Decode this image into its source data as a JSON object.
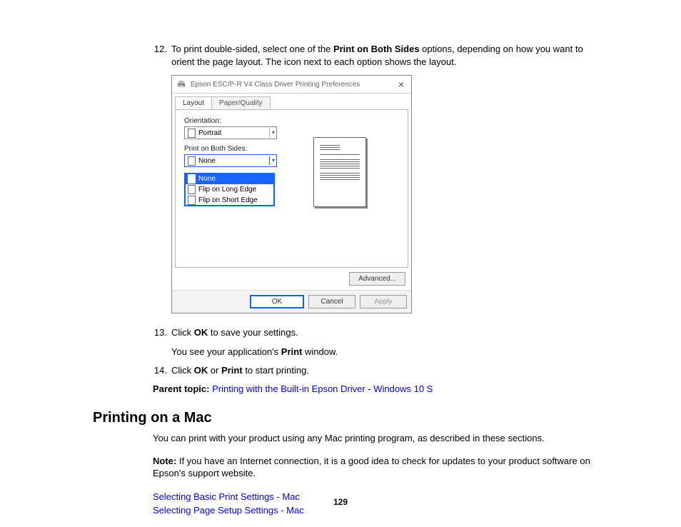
{
  "steps": {
    "s12": {
      "num": "12.",
      "text_before": "To print double-sided, select one of the ",
      "bold1": "Print on Both Sides",
      "text_after": " options, depending on how you want to orient the page layout. The icon next to each option shows the layout."
    },
    "s13": {
      "num": "13.",
      "text_before": "Click ",
      "bold1": "OK",
      "text_after": " to save your settings."
    },
    "s13_sub": {
      "text_before": "You see your application's ",
      "bold1": "Print",
      "text_after": " window."
    },
    "s14": {
      "num": "14.",
      "text_before": "Click ",
      "bold1": "OK",
      "mid": " or ",
      "bold2": "Print",
      "text_after": " to start printing."
    }
  },
  "parent_topic": {
    "label": "Parent topic:",
    "link": "Printing with the Built-in Epson Driver - Windows 10 S"
  },
  "heading": "Printing on a Mac",
  "para1": "You can print with your product using any Mac printing program, as described in these sections.",
  "note": {
    "label": "Note:",
    "text": " If you have an Internet connection, it is a good idea to check for updates to your product software on Epson's support website."
  },
  "links": {
    "l1": "Selecting Basic Print Settings - Mac",
    "l2": "Selecting Page Setup Settings - Mac"
  },
  "page_number": "129",
  "dialog": {
    "title": "Epson ESC/P-R V4 Class Driver Printing Preferences",
    "close": "×",
    "tabs": {
      "layout": "Layout",
      "paper": "Paper/Quality"
    },
    "orientation_label": "Orientation:",
    "orientation_value": "Portrait",
    "both_sides_label": "Print on Both Sides:",
    "both_sides_value": "None",
    "options": {
      "none": "None",
      "long": "Flip on Long Edge",
      "short": "Flip on Short Edge"
    },
    "advanced": "Advanced...",
    "ok": "OK",
    "cancel": "Cancel",
    "apply": "Apply"
  }
}
